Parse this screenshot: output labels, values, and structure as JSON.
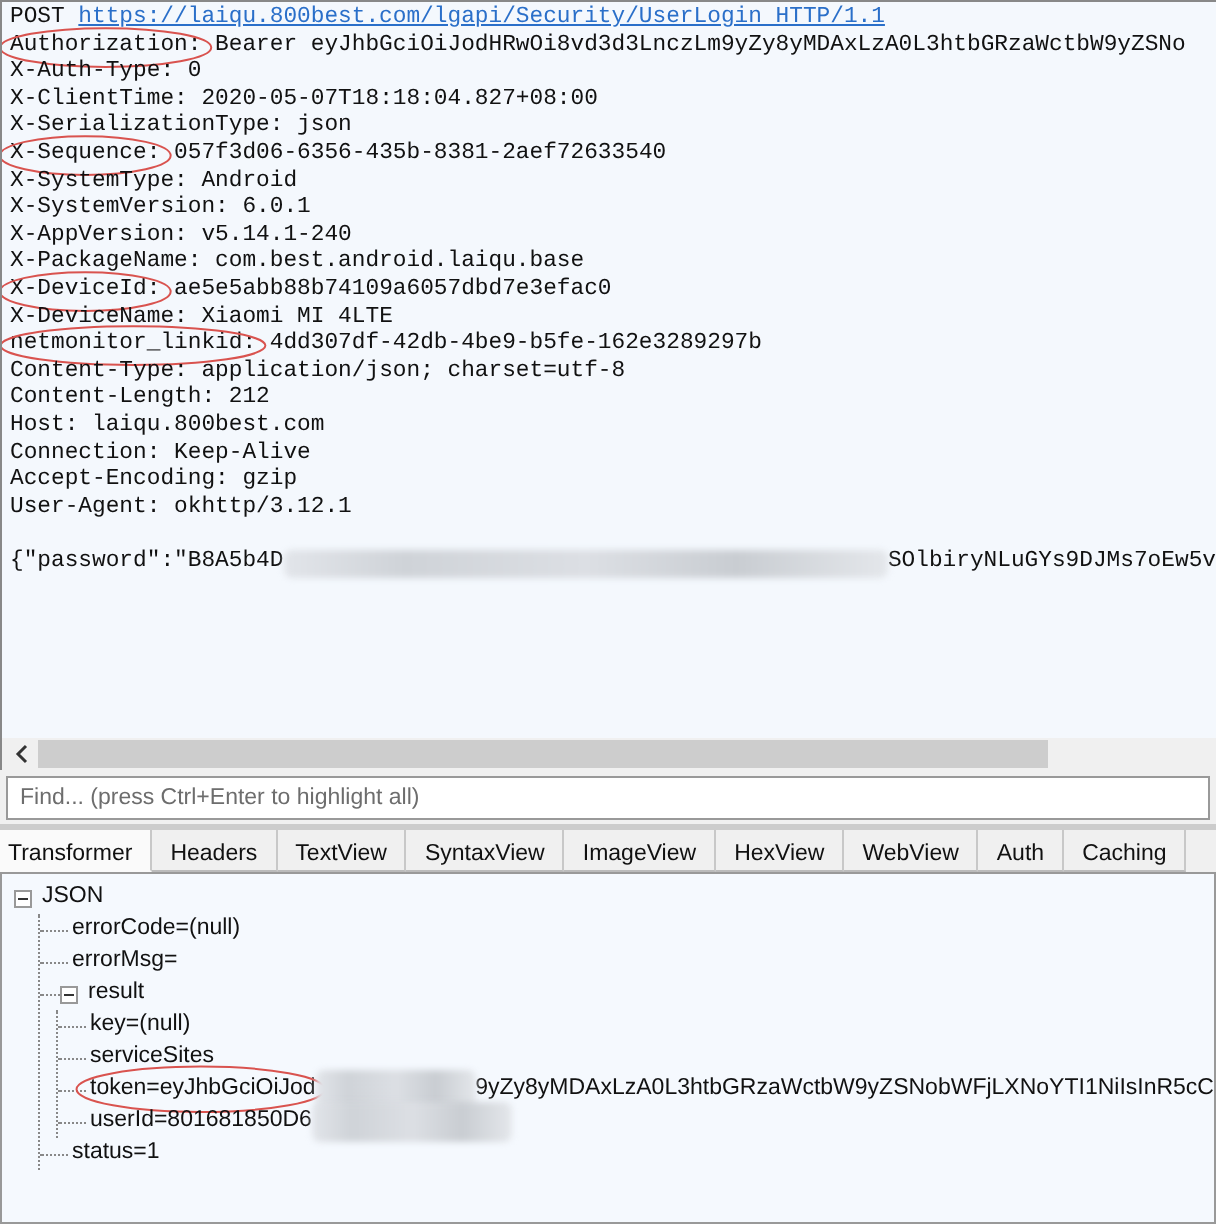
{
  "request_line": {
    "method": "POST",
    "url": "https://laiqu.800best.com/lgapi/Security/UserLogin HTTP/1.1"
  },
  "headers": [
    {
      "name": "Authorization:",
      "value": "Bearer eyJhbGciOiJodHRwOi8vd3d3LnczLm9yZy8yMDAxLzA0L3htbGRzaWctbW9yZSNo",
      "circled": true
    },
    {
      "name": "X-Auth-Type:",
      "value": "0",
      "circled": false
    },
    {
      "name": "X-ClientTime:",
      "value": "2020-05-07T18:18:04.827+08:00",
      "circled": false
    },
    {
      "name": "X-SerializationType:",
      "value": "json",
      "circled": false
    },
    {
      "name": "X-Sequence:",
      "value": "057f3d06-6356-435b-8381-2aef72633540",
      "circled": true
    },
    {
      "name": "X-SystemType:",
      "value": "Android",
      "circled": false
    },
    {
      "name": "X-SystemVersion:",
      "value": "6.0.1",
      "circled": false
    },
    {
      "name": "X-AppVersion:",
      "value": "v5.14.1-240",
      "circled": false
    },
    {
      "name": "X-PackageName:",
      "value": "com.best.android.laiqu.base",
      "circled": false
    },
    {
      "name": "X-DeviceId:",
      "value": "ae5e5abb88b74109a6057dbd7e3efac0",
      "circled": true
    },
    {
      "name": "X-DeviceName:",
      "value": "Xiaomi MI 4LTE",
      "circled": false
    },
    {
      "name": "netmonitor_linkid:",
      "value": "4dd307df-42db-4be9-b5fe-162e3289297b",
      "circled": true
    },
    {
      "name": "Content-Type:",
      "value": "application/json; charset=utf-8",
      "circled": false
    },
    {
      "name": "Content-Length:",
      "value": "212",
      "circled": false
    },
    {
      "name": "Host:",
      "value": "laiqu.800best.com",
      "circled": false
    },
    {
      "name": "Connection:",
      "value": "Keep-Alive",
      "circled": false
    },
    {
      "name": "Accept-Encoding:",
      "value": "gzip",
      "circled": false
    },
    {
      "name": "User-Agent:",
      "value": "okhttp/3.12.1",
      "circled": false
    }
  ],
  "body": {
    "before_blur": "{\"password\":\"B8A5b4D",
    "after_blur": "SOlbiryNLuGYs9DJMs7oEw5v"
  },
  "find": {
    "placeholder": "Find... (press Ctrl+Enter to highlight all)"
  },
  "tabs": [
    {
      "label": "Transformer",
      "selected": true
    },
    {
      "label": "Headers",
      "selected": false
    },
    {
      "label": "TextView",
      "selected": false
    },
    {
      "label": "SyntaxView",
      "selected": false
    },
    {
      "label": "ImageView",
      "selected": false
    },
    {
      "label": "HexView",
      "selected": false
    },
    {
      "label": "WebView",
      "selected": false
    },
    {
      "label": "Auth",
      "selected": false
    },
    {
      "label": "Caching",
      "selected": false
    }
  ],
  "tree": [
    {
      "label": "JSON",
      "expanded": true,
      "children": [
        {
          "label": "errorCode=(null)"
        },
        {
          "label": "errorMsg="
        },
        {
          "label": "result",
          "expanded": true,
          "children": [
            {
              "label": "key=(null)"
            },
            {
              "label": "serviceSites"
            },
            {
              "label": "token=eyJhbGciOiJod",
              "blurred": true,
              "after_blur": "9yZy8yMDAxLzA0L3htbGRzaWctbW9yZSNobWFjLXNoYTI1NiIsInR5cC",
              "circled": true
            },
            {
              "label": "userId=801681850D6",
              "blurred": true
            }
          ]
        },
        {
          "label": "status=1"
        }
      ]
    }
  ]
}
